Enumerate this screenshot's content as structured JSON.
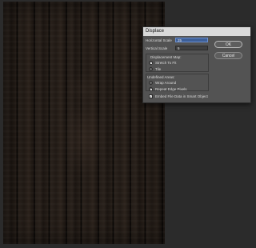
{
  "dialog": {
    "title": "Displace",
    "horizontal_scale": {
      "label": "Horizontal Scale",
      "value": "25"
    },
    "vertical_scale": {
      "label": "Vertical Scale",
      "value": "5"
    },
    "displacement_map": {
      "heading": "Displacement Map:",
      "options": [
        "Stretch To Fit",
        "Tile"
      ],
      "selected": "Stretch To Fit"
    },
    "undefined_areas": {
      "heading": "Undefined Areas:",
      "options": [
        "Wrap Around",
        "Repeat Edge Pixels"
      ],
      "selected": "Repeat Edge Pixels"
    },
    "embed_checkbox": {
      "label": "Embed File Data in Smart Object",
      "checked": true
    },
    "ok_label": "OK",
    "cancel_label": "Cancel"
  }
}
